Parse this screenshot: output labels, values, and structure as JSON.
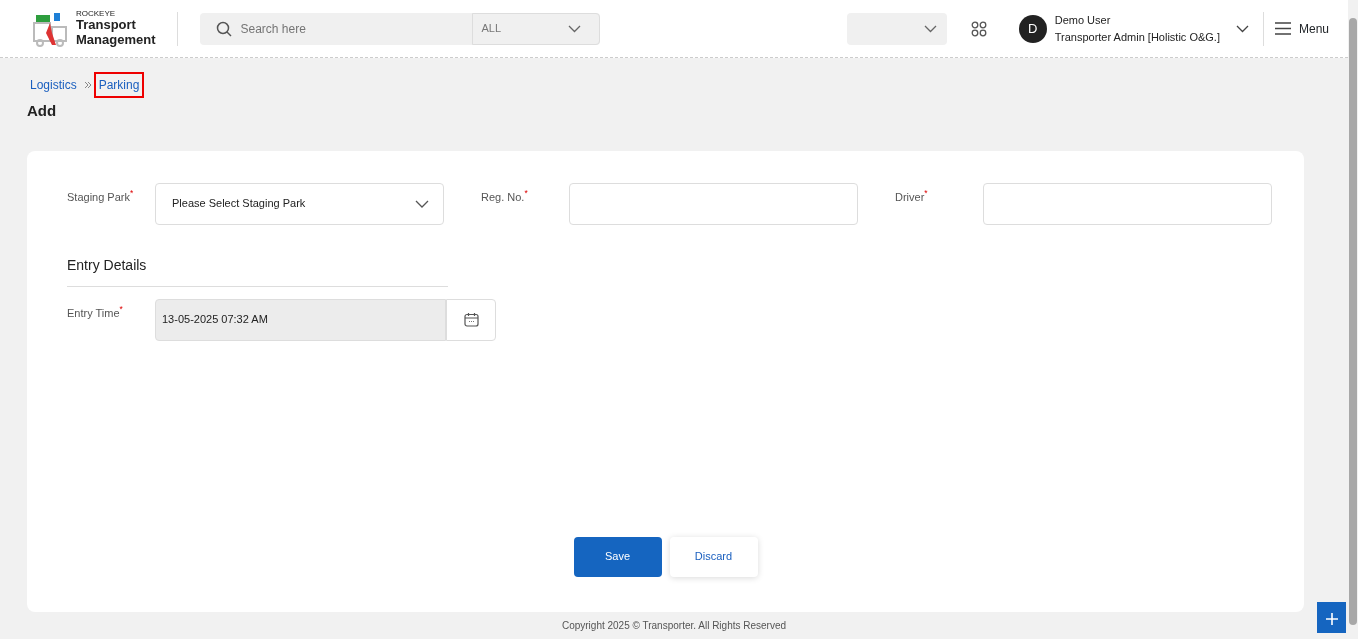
{
  "header": {
    "logo": {
      "brand": "ROCKEYE",
      "title_line_1": "Transport",
      "title_line_2": "Management"
    },
    "search": {
      "placeholder": "Search here",
      "scope": "ALL"
    },
    "user": {
      "initial": "D",
      "name": "Demo User",
      "role": "Transporter Admin [Holistic O&G.]"
    },
    "menu_label": "Menu"
  },
  "breadcrumb": [
    {
      "label": "Logistics",
      "highlighted": false
    },
    {
      "label": "Parking",
      "highlighted": true
    }
  ],
  "page_title": "Add",
  "fields": [
    {
      "kind": "select",
      "label": "Staging Park",
      "required_mark": "*",
      "placeholder": "Please Select Staging Park"
    },
    {
      "kind": "text",
      "label": "Reg. No.",
      "required_mark": "*"
    },
    {
      "kind": "text",
      "label": "Driver",
      "required_mark": "*"
    }
  ],
  "entry_details": {
    "title": "Entry Details",
    "entry_time": {
      "label": "Entry Time",
      "required_mark": "*",
      "value": "13-05-2025 07:32 AM"
    }
  },
  "buttons": {
    "save": "Save",
    "discard": "Discard"
  },
  "footer": "Copyright 2025 © Transporter. All Rights Reserved"
}
